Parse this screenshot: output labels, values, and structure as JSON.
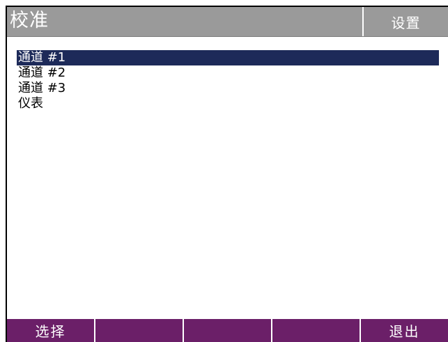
{
  "title": "校准",
  "setup_label": "设置",
  "menu": {
    "items": [
      {
        "label": "通道 #1",
        "selected": true
      },
      {
        "label": "通道 #2",
        "selected": false
      },
      {
        "label": "通道 #3",
        "selected": false
      },
      {
        "label": "仪表",
        "selected": false
      }
    ]
  },
  "softkeys": {
    "labels": [
      "选择",
      "",
      "",
      "",
      "退出"
    ]
  },
  "colors": {
    "titlebar": "#9a9a9a",
    "selection": "#1d2a59",
    "softkey": "#6b1f68"
  }
}
